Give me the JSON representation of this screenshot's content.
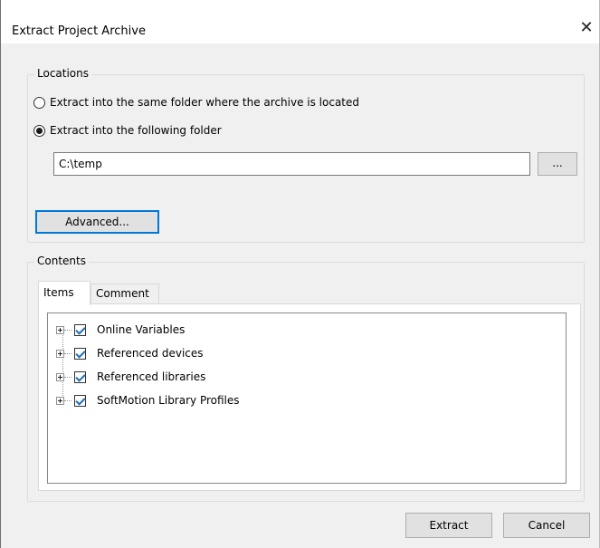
{
  "window": {
    "title": "Extract Project Archive",
    "close_glyph": "✕"
  },
  "locations": {
    "label": "Locations",
    "option_same_folder": "Extract into the same folder where the archive is located",
    "option_following_folder": "Extract into the following folder",
    "selected_option": "following_folder",
    "folder_path": "C:\\temp",
    "browse_label": "...",
    "advanced_label": "Advanced..."
  },
  "contents": {
    "label": "Contents",
    "tabs": [
      {
        "label": "Items",
        "active": true
      },
      {
        "label": "Comment",
        "active": false
      }
    ],
    "items": [
      {
        "label": "Online Variables",
        "checked": true,
        "expandable": true
      },
      {
        "label": "Referenced devices",
        "checked": true,
        "expandable": true
      },
      {
        "label": "Referenced libraries",
        "checked": true,
        "expandable": true
      },
      {
        "label": "SoftMotion Library Profiles",
        "checked": true,
        "expandable": true
      }
    ]
  },
  "footer": {
    "extract_label": "Extract",
    "cancel_label": "Cancel"
  },
  "colors": {
    "focus_border": "#0078d7",
    "check_mark": "#1e6fb8"
  }
}
